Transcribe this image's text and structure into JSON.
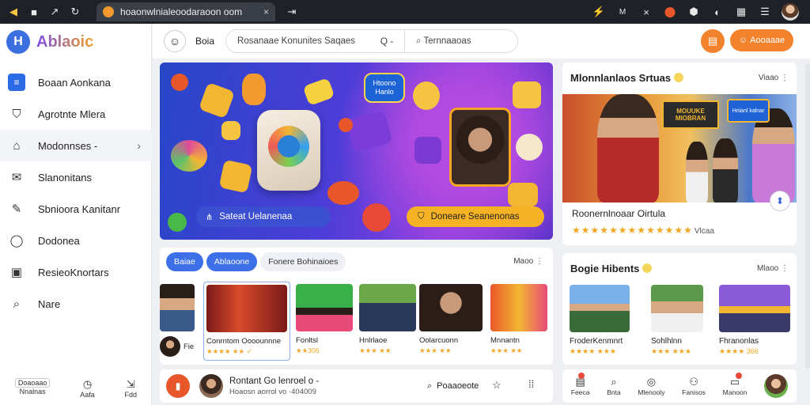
{
  "browser": {
    "tab_title": "hoaonwlnialeoodaraoon oom",
    "tab_close": "×",
    "tab_extra": "⇥",
    "icons": [
      "back-icon",
      "tab-icon",
      "share-icon",
      "reload-icon",
      "lightning-icon",
      "settings-icon",
      "close-icon",
      "extension-icon",
      "shield-icon",
      "info-icon",
      "bookmark-icon",
      "menu-icon"
    ],
    "right_labels": [
      "M",
      "⁄ ¡"
    ]
  },
  "sidebar": {
    "logo_letter": "H",
    "logo_text": "Ablaoic",
    "items": [
      {
        "label": "Boaan Aonkana",
        "icon": "list-icon"
      },
      {
        "label": "Agrotnte Mlera",
        "icon": "shield-icon"
      },
      {
        "label": "Modonnses -",
        "icon": "home-icon"
      },
      {
        "label": "Slanonitans",
        "icon": "mail-icon"
      },
      {
        "label": "Sbnioora Kanitanr",
        "icon": "edit-icon"
      },
      {
        "label": "Dodonea",
        "icon": "chat-icon"
      },
      {
        "label": "ResieoKnortars",
        "icon": "image-icon"
      },
      {
        "label": "Nare",
        "icon": "search-icon"
      }
    ],
    "bottom": [
      {
        "label": "Doaoaao",
        "sub": "Nnalnas"
      },
      {
        "label": "",
        "sub": "Aafa"
      },
      {
        "label": "",
        "sub": "Fdd"
      }
    ]
  },
  "header": {
    "label": "Boia",
    "search_left": "Rosanaae Konunites  Saqaes",
    "search_q": "Q -",
    "search_right": "Ternnaaoas",
    "orange_button": "Aooaaae"
  },
  "hero": {
    "tag": "Htoono Hanlo",
    "button_left": "Sateat Uelanenaa",
    "button_right": "Doneare Seanenonas"
  },
  "featured": {
    "title": "Mlonnlanlaos Srtuas",
    "more": "Viaao",
    "sign1": "MOUUKE MIOBRAN",
    "sign2": "Hriianl kalnar",
    "caption": "Roonernlnoaar Oirtula",
    "rating_stars": "★★★★★★★★★★★★★",
    "rating_value": "Vlcaa"
  },
  "carousel": {
    "chip1": "Baiae",
    "chip2": "Ablaoone",
    "chip3": "Fonere Bohinaioes",
    "more": "Maoo",
    "tiles": [
      {
        "caption": "Fie",
        "sub": ""
      },
      {
        "caption": "Conrntom Oooounnne",
        "sub": "★★★★ ★★ ✓"
      },
      {
        "caption": "Fonltsl",
        "sub": "★★306"
      },
      {
        "caption": "Hnlrlaoe",
        "sub": "★★★ ★★"
      },
      {
        "caption": "Oolarcuonn",
        "sub": "★★★ ★★"
      },
      {
        "caption": "Mnnantn",
        "sub": "★★★ ★★"
      }
    ]
  },
  "guide": {
    "title": "Bogie Hibents",
    "more": "Mlaoo",
    "tiles": [
      {
        "caption": "FroderKenmnrt",
        "sub": "★★★★ ★★★"
      },
      {
        "caption": "Sohlhlnn",
        "sub": "★★★ ★★★"
      },
      {
        "caption": "Fhranonlas",
        "sub": "★★★★ 366"
      }
    ]
  },
  "bottom_bar": {
    "name": "Rontant Go lenroel o -",
    "sub": "Hoaosn aorrol vo ·404009",
    "search": "Poaaoeote"
  },
  "tabbar": [
    {
      "label": "Feeca",
      "icon": "feed-icon",
      "dot": true
    },
    {
      "label": "Bnta",
      "icon": "search-icon",
      "dot": false
    },
    {
      "label": "Mlenooly",
      "icon": "compass-icon",
      "dot": false
    },
    {
      "label": "Fanisos",
      "icon": "people-icon",
      "dot": false
    },
    {
      "label": "Manoon",
      "icon": "inbox-icon",
      "dot": true
    }
  ],
  "colors": {
    "accent": "#2c6be6",
    "orange": "#f2832c",
    "star": "#f2a623",
    "browser_bar": "#1e2127"
  }
}
